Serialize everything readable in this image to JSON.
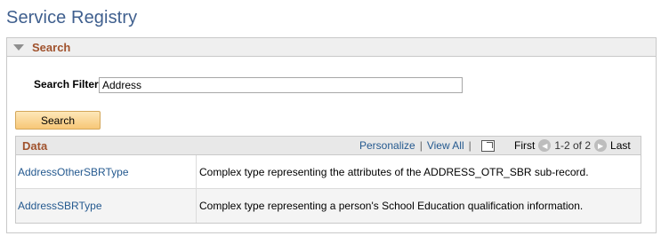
{
  "page": {
    "title": "Service Registry"
  },
  "search_section": {
    "title": "Search",
    "filter_label": "Search Filter",
    "filter_value": "Address",
    "search_button": "Search"
  },
  "grid": {
    "title": "Data",
    "personalize": "Personalize",
    "view_all": "View All",
    "separator": "|",
    "first": "First",
    "range": "1-2 of 2",
    "last": "Last",
    "rows": [
      {
        "name": "AddressOtherSBRType",
        "description": "Complex type representing the attributes of the ADDRESS_OTR_SBR sub-record."
      },
      {
        "name": "AddressSBRType",
        "description": "Complex type representing a person's School Education qualification information."
      }
    ]
  }
}
